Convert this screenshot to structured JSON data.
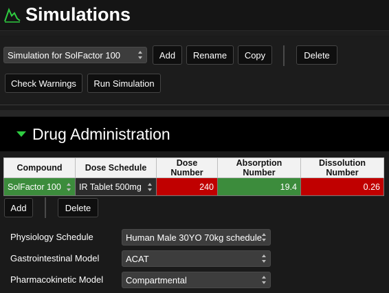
{
  "app": {
    "title": "Simulations",
    "logo_icon": "curve-logo-icon",
    "accent": "#2ecc40"
  },
  "toolbar": {
    "simulation_select": "Simulation for SolFactor 100",
    "add_label": "Add",
    "rename_label": "Rename",
    "copy_label": "Copy",
    "delete_label": "Delete",
    "check_warnings_label": "Check Warnings",
    "run_simulation_label": "Run Simulation"
  },
  "section": {
    "title": "Drug Administration",
    "expand_icon": "triangle-down-icon"
  },
  "table": {
    "columns": [
      "Compound",
      "Dose Schedule",
      "Dose Number",
      "Absorption Number",
      "Dissolution Number"
    ],
    "rows": [
      {
        "compound": "SolFactor 100",
        "dose_schedule": "IR Tablet 500mg",
        "dose_number": "240",
        "absorption_number": "19.4",
        "dissolution_number": "0.26"
      }
    ],
    "status_colors": {
      "red": "#c00000",
      "green": "#3c8c3c"
    }
  },
  "row_actions": {
    "add_label": "Add",
    "delete_label": "Delete"
  },
  "form": {
    "physiology_label": "Physiology Schedule",
    "physiology_value": "Human Male 30YO 70kg schedule",
    "gi_label": "Gastrointestinal Model",
    "gi_value": "ACAT",
    "pk_label": "Pharmacokinetic Model",
    "pk_value": "Compartmental"
  }
}
